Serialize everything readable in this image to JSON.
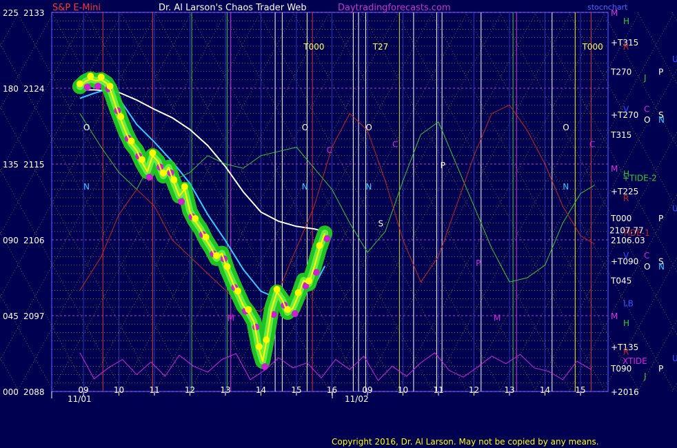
{
  "header": {
    "symbol": "S&P E-Mini",
    "title": "Dr. Al Larson's Chaos Trader Web",
    "site": "Daytradingforecasts.com",
    "corner_tag": "stocnchart"
  },
  "copyright": "Copyright 2016, Dr. Al Larson. May not be copied by any means.",
  "colors": {
    "background": "#000050",
    "price_bars": "#ffff00",
    "green_band": "#22cc22",
    "magenta_points": "#cc22cc",
    "slow_avg": "#ffffff",
    "fast_avg": "#33ccff",
    "tide_red": "#cc2222",
    "tide_green": "#33cc33",
    "xtide": "#dd22dd"
  },
  "chart_data": {
    "type": "line",
    "title": "S&P E-Mini",
    "xlabel": "",
    "ylabel": "",
    "ylim": [
      2088,
      2133
    ],
    "grid": true,
    "y_ticks": [
      {
        "angle": "225",
        "price": "2133"
      },
      {
        "angle": "180",
        "price": "2124"
      },
      {
        "angle": "135",
        "price": "2115"
      },
      {
        "angle": "090",
        "price": "2106"
      },
      {
        "angle": "045",
        "price": "2097"
      },
      {
        "angle": "000",
        "price": "2088"
      }
    ],
    "x_ticks": [
      "09",
      "10",
      "11",
      "12",
      "13",
      "14",
      "15",
      "16",
      "09",
      "10",
      "11",
      "12",
      "13",
      "14",
      "15"
    ],
    "day_labels": [
      "11/01",
      "11/02"
    ],
    "x_hours": [
      9,
      10,
      11,
      12,
      13,
      14,
      15,
      16,
      17,
      18,
      19,
      20,
      21,
      22,
      23
    ],
    "price_series": {
      "name": "Price",
      "x": [
        8.9,
        9.05,
        9.2,
        9.35,
        9.5,
        9.65,
        9.75,
        9.9,
        10.05,
        10.2,
        10.35,
        10.5,
        10.65,
        10.8,
        10.95,
        11.1,
        11.25,
        11.4,
        11.55,
        11.7,
        11.85,
        12.0,
        12.15,
        12.3,
        12.45,
        12.6,
        12.75,
        12.9,
        13.05,
        13.2,
        13.35,
        13.5,
        13.65,
        13.8,
        13.95,
        14.05,
        14.15,
        14.3,
        14.45,
        14.6,
        14.75,
        14.9,
        15.05,
        15.2,
        15.35,
        15.5,
        15.65,
        15.8
      ],
      "y": [
        2124.2,
        2124.8,
        2125.1,
        2124.9,
        2125.0,
        2124.6,
        2123.9,
        2122.0,
        2120.3,
        2118.7,
        2117.4,
        2116.6,
        2115.2,
        2114.1,
        2116.0,
        2115.3,
        2113.6,
        2114.6,
        2112.8,
        2111.2,
        2112.0,
        2109.4,
        2108.2,
        2107.3,
        2106.0,
        2105.0,
        2103.8,
        2104.4,
        2102.5,
        2101.0,
        2099.6,
        2098.2,
        2097.4,
        2096.3,
        2093.0,
        2091.6,
        2093.8,
        2097.8,
        2099.8,
        2098.9,
        2097.4,
        2097.9,
        2099.4,
        2101.2,
        2100.8,
        2102.8,
        2105.0,
        2106.8
      ]
    },
    "series": [
      {
        "name": "slow average",
        "x": [
          8.9,
          9.3,
          9.7,
          10.0,
          10.5,
          11.0,
          11.5,
          12.0,
          12.5,
          13.0,
          13.5,
          14.0,
          14.5,
          15.0,
          15.5,
          15.8
        ],
        "y": [
          2123.8,
          2123.8,
          2123.7,
          2123.5,
          2122.6,
          2121.5,
          2120.5,
          2119.1,
          2117.2,
          2114.7,
          2111.7,
          2109.3,
          2108.2,
          2107.6,
          2107.3,
          2107.0
        ]
      },
      {
        "name": "fast average",
        "x": [
          8.9,
          9.3,
          9.7,
          10.0,
          10.5,
          11.0,
          11.5,
          12.0,
          12.5,
          13.0,
          13.5,
          14.0,
          14.5,
          15.0,
          15.5,
          15.8
        ],
        "y": [
          2122.8,
          2123.4,
          2123.9,
          2122.8,
          2119.7,
          2117.6,
          2115.3,
          2112.7,
          2109.0,
          2105.9,
          2102.5,
          2099.9,
          2099.0,
          2098.9,
          2100.5,
          2102.9
        ]
      },
      {
        "name": "TIDE-2",
        "x": [
          8.9,
          9.5,
          10.0,
          10.5,
          11.0,
          11.5,
          12.0,
          12.5,
          13.0,
          13.5,
          14.0,
          14.5,
          15.0,
          15.5,
          16.0,
          16.5,
          17.0,
          17.5,
          18.0,
          18.5,
          19.0,
          19.5,
          20.0,
          20.5,
          21.0,
          21.5,
          22.0,
          22.5,
          23.0,
          23.4
        ],
        "y": [
          2121.0,
          2117.0,
          2114.0,
          2112.0,
          2116.0,
          2113.0,
          2114.0,
          2116.0,
          2115.0,
          2114.5,
          2116.0,
          2116.5,
          2117.0,
          2114.5,
          2112.0,
          2108.0,
          2104.5,
          2107.0,
          2113.0,
          2118.5,
          2120.0,
          2115.0,
          2110.0,
          2105.0,
          2101.0,
          2101.5,
          2103.0,
          2108.0,
          2111.5,
          2112.5
        ]
      },
      {
        "name": "TIDE-1",
        "x": [
          8.9,
          9.5,
          10.0,
          10.5,
          11.0,
          11.5,
          12.0,
          12.5,
          13.0,
          13.5,
          14.0,
          14.5,
          15.0,
          15.5,
          16.0,
          16.5,
          17.0,
          17.5,
          18.0,
          18.5,
          19.0,
          19.5,
          20.0,
          20.5,
          21.0,
          21.5,
          22.0,
          22.5,
          23.0,
          23.4
        ],
        "y": [
          2100.0,
          2104.0,
          2109.0,
          2112.0,
          2110.0,
          2106.0,
          2104.0,
          2102.0,
          2100.0,
          2098.0,
          2097.5,
          2100.0,
          2105.0,
          2110.0,
          2117.0,
          2121.0,
          2119.0,
          2113.0,
          2106.0,
          2101.0,
          2104.0,
          2110.0,
          2116.0,
          2121.0,
          2122.0,
          2119.0,
          2115.0,
          2110.0,
          2106.5,
          2105.5
        ]
      },
      {
        "name": "XTIDE",
        "x": [
          8.9,
          9.3,
          9.7,
          10.1,
          10.5,
          10.9,
          11.3,
          11.7,
          12.1,
          12.5,
          12.9,
          13.3,
          13.7,
          14.1,
          14.5,
          14.9,
          15.3,
          15.7,
          16.1,
          16.5,
          16.9,
          17.3,
          17.7,
          18.1,
          18.5,
          18.9,
          19.3,
          19.7,
          20.1,
          20.5,
          20.9,
          21.3,
          21.7,
          22.1,
          22.5,
          22.9,
          23.3
        ],
        "y": [
          2092.6,
          2089.5,
          2090.8,
          2091.8,
          2090.0,
          2091.5,
          2089.8,
          2092.3,
          2091.0,
          2090.3,
          2091.8,
          2092.5,
          2089.4,
          2090.5,
          2092.0,
          2090.8,
          2091.4,
          2089.6,
          2091.8,
          2090.6,
          2092.2,
          2089.3,
          2091.0,
          2089.8,
          2091.4,
          2092.6,
          2090.5,
          2089.7,
          2090.9,
          2092.2,
          2091.3,
          2092.4,
          2090.8,
          2090.4,
          2089.4,
          2091.6,
          2090.6
        ]
      }
    ],
    "price_labels": [
      "2107.77",
      "2106.03",
      "2016"
    ],
    "right_labels": [
      {
        "text": "M",
        "price": 2133
      },
      {
        "text": "+T315",
        "price": 2129.5
      },
      {
        "text": "T270",
        "price": 2126
      },
      {
        "text": "+T270",
        "price": 2120.9
      },
      {
        "text": "T315",
        "price": 2118.5
      },
      {
        "text": "M",
        "price": 2114.5
      },
      {
        "text": "+T225",
        "price": 2111.8
      },
      {
        "text": "T000",
        "price": 2108.6
      },
      {
        "text": "+T090",
        "price": 2103.5
      },
      {
        "text": "T045",
        "price": 2101.2
      },
      {
        "text": "M",
        "price": 2097
      },
      {
        "text": "+T135",
        "price": 2093.3
      },
      {
        "text": "T090",
        "price": 2090.8
      },
      {
        "text": "+2016",
        "price": 2088
      }
    ],
    "side_letters": [
      {
        "text": "H",
        "price": 2132,
        "col": 0,
        "color": "#33cc33"
      },
      {
        "text": "R",
        "price": 2129,
        "col": 0,
        "color": "#cc2222"
      },
      {
        "text": "U",
        "price": 2127.5,
        "col": 3,
        "color": "#3355ff"
      },
      {
        "text": "P",
        "price": 2126,
        "col": 2,
        "color": "#ffffff"
      },
      {
        "text": "J",
        "price": 2125.3,
        "col": 1,
        "color": "#33cc33"
      },
      {
        "text": "V",
        "price": 2121.6,
        "col": 0,
        "color": "#3355ff"
      },
      {
        "text": "C",
        "price": 2121.6,
        "col": 1,
        "color": "#dd22dd"
      },
      {
        "text": "S",
        "price": 2120.9,
        "col": 2,
        "color": "#ffffff"
      },
      {
        "text": "O",
        "price": 2120.3,
        "col": 1,
        "color": "#ffffff"
      },
      {
        "text": "N",
        "price": 2120.3,
        "col": 2,
        "color": "#33ccff"
      },
      {
        "text": "H",
        "price": 2113.9,
        "col": 0,
        "color": "#33cc33"
      },
      {
        "text": "R",
        "price": 2111,
        "col": 0,
        "color": "#cc2222"
      },
      {
        "text": "U",
        "price": 2109.8,
        "col": 3,
        "color": "#3355ff"
      },
      {
        "text": "P",
        "price": 2108.6,
        "col": 2,
        "color": "#ffffff"
      },
      {
        "text": "V",
        "price": 2104.2,
        "col": 0,
        "color": "#3355ff"
      },
      {
        "text": "C",
        "price": 2104.2,
        "col": 1,
        "color": "#dd22dd"
      },
      {
        "text": "S",
        "price": 2103.5,
        "col": 2,
        "color": "#ffffff"
      },
      {
        "text": "O",
        "price": 2102.9,
        "col": 1,
        "color": "#ffffff"
      },
      {
        "text": "N",
        "price": 2102.9,
        "col": 2,
        "color": "#33ccff"
      },
      {
        "text": "LB",
        "price": 2098.5,
        "col": 0,
        "color": "#3355ff"
      },
      {
        "text": "H",
        "price": 2096.2,
        "col": 0,
        "color": "#33cc33"
      },
      {
        "text": "R",
        "price": 2092.8,
        "col": 0,
        "color": "#cc2222"
      },
      {
        "text": "U",
        "price": 2092,
        "col": 3,
        "color": "#3355ff"
      },
      {
        "text": "P",
        "price": 2090.8,
        "col": 2,
        "color": "#ffffff"
      },
      {
        "text": "J",
        "price": 2089.9,
        "col": 1,
        "color": "#33cc33"
      }
    ],
    "legend": [
      {
        "text": "+TIDE-2",
        "price": 2113.4,
        "color": "#33cc33"
      },
      {
        "text": "TIDE-1",
        "price": 2106.9,
        "color": "#cc2222"
      },
      {
        "text": "XTIDE",
        "price": 2091.7,
        "color": "#dd22dd"
      }
    ],
    "vertical_lines": [
      {
        "hour": 9.55,
        "color": "#dd3333"
      },
      {
        "hour": 10.95,
        "color": "#dd3333"
      },
      {
        "hour": 12.05,
        "color": "#33cc33"
      },
      {
        "hour": 13.05,
        "color": "#33cc33"
      },
      {
        "hour": 13.15,
        "color": "#dd33dd"
      },
      {
        "hour": 14.4,
        "color": "#ffffff"
      },
      {
        "hour": 14.6,
        "color": "#ffffff"
      },
      {
        "hour": 15.3,
        "color": "#ffffff"
      },
      {
        "hour": 15.45,
        "color": "#dd3333"
      },
      {
        "hour": 16.6,
        "color": "#ffffff"
      },
      {
        "hour": 16.75,
        "color": "#ffffff"
      },
      {
        "hour": 16.95,
        "color": "#ffffff"
      },
      {
        "hour": 17.9,
        "color": "#dddd33"
      },
      {
        "hour": 18.3,
        "color": "#ffffff"
      },
      {
        "hour": 18.95,
        "color": "#ffffff"
      },
      {
        "hour": 19.1,
        "color": "#ffffff"
      },
      {
        "hour": 20.2,
        "color": "#ffffff"
      },
      {
        "hour": 21.1,
        "color": "#33cc33"
      },
      {
        "hour": 21.2,
        "color": "#dd33dd"
      },
      {
        "hour": 22.2,
        "color": "#ffffff"
      },
      {
        "hour": 22.85,
        "color": "#ffff00"
      },
      {
        "hour": 23.3,
        "color": "#dd3333"
      }
    ],
    "time_markers": [
      {
        "text": "T000",
        "hour": 15.2,
        "price": 2129
      },
      {
        "text": "T27",
        "hour": 17.15,
        "price": 2129
      },
      {
        "text": "T000",
        "hour": 23.05,
        "price": 2129
      }
    ],
    "chart_letters": [
      {
        "text": "O",
        "hour": 9.0,
        "price": 2119.4,
        "color": "#ffffff"
      },
      {
        "text": "N",
        "hour": 9.0,
        "price": 2112.4,
        "color": "#33ccff"
      },
      {
        "text": "O",
        "hour": 15.15,
        "price": 2119.4,
        "color": "#ffffff"
      },
      {
        "text": "N",
        "hour": 15.15,
        "price": 2112.4,
        "color": "#33ccff"
      },
      {
        "text": "C",
        "hour": 15.85,
        "price": 2116.7,
        "color": "#dd22dd"
      },
      {
        "text": "O",
        "hour": 16.95,
        "price": 2119.4,
        "color": "#ffffff"
      },
      {
        "text": "N",
        "hour": 16.95,
        "price": 2112.4,
        "color": "#33ccff"
      },
      {
        "text": "C",
        "hour": 17.7,
        "price": 2117.4,
        "color": "#dd22dd"
      },
      {
        "text": "S",
        "hour": 17.3,
        "price": 2108.0,
        "color": "#ffffff"
      },
      {
        "text": "P",
        "hour": 19.05,
        "price": 2114.9,
        "color": "#ffffff"
      },
      {
        "text": "P",
        "hour": 20.05,
        "price": 2103.3,
        "color": "#dd22dd"
      },
      {
        "text": "M",
        "hour": 20.55,
        "price": 2096.8,
        "color": "#dd22dd"
      },
      {
        "text": "O",
        "hour": 22.5,
        "price": 2119.4,
        "color": "#ffffff"
      },
      {
        "text": "N",
        "hour": 22.5,
        "price": 2112.4,
        "color": "#33ccff"
      },
      {
        "text": "C",
        "hour": 23.25,
        "price": 2117.4,
        "color": "#dd22dd"
      },
      {
        "text": "M",
        "hour": 13.05,
        "price": 2096.8,
        "color": "#dd22dd"
      }
    ]
  }
}
